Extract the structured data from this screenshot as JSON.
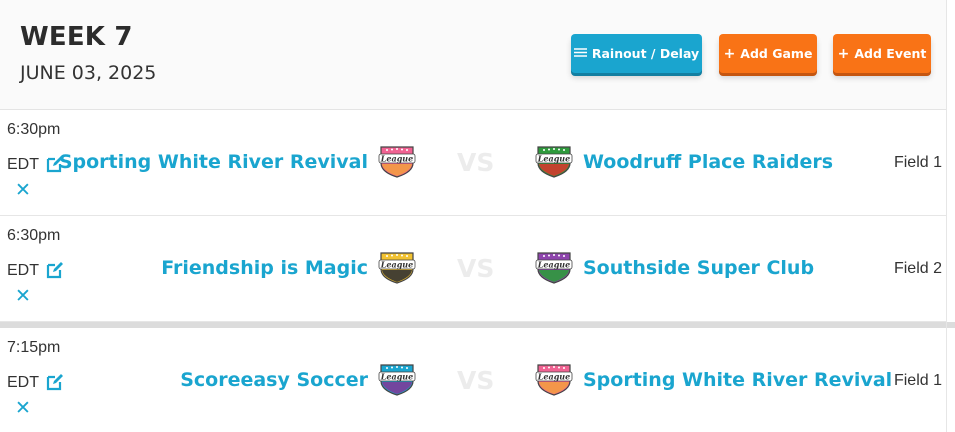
{
  "header": {
    "week_title": "WEEK 7",
    "date": "JUNE 03, 2025",
    "buttons": {
      "rainout": {
        "icon": "waves-icon",
        "label": "Rainout / Delay",
        "color": "#1aa5cf"
      },
      "add_game": {
        "icon": "plus-icon",
        "label": "Add Game",
        "color": "#f97316"
      },
      "add_event": {
        "icon": "plus-icon",
        "label": "Add Event",
        "color": "#f97316"
      }
    }
  },
  "vs_label": "VS",
  "games": [
    {
      "time": "6:30pm",
      "timezone": "EDT",
      "home": {
        "name": "Sporting White River Revival",
        "badge_color": "#f06292",
        "badge_stripe": "#f39c42",
        "badge_text": "League"
      },
      "away": {
        "name": "Woodruff Place Raiders",
        "badge_color": "#2e9a3c",
        "badge_stripe": "#d33a2c",
        "badge_text": "League"
      },
      "field": "Field 1"
    },
    {
      "time": "6:30pm",
      "timezone": "EDT",
      "home": {
        "name": "Friendship is Magic",
        "badge_color": "#f2c230",
        "badge_stripe": "#333333",
        "badge_text": "League"
      },
      "away": {
        "name": "Southside Super Club",
        "badge_color": "#8e44ad",
        "badge_stripe": "#2e9a3c",
        "badge_text": "League"
      },
      "field": "Field 2"
    },
    {
      "time": "7:15pm",
      "timezone": "EDT",
      "home": {
        "name": "Scoreeasy Soccer",
        "badge_color": "#1aa5cf",
        "badge_stripe": "#7d3c98",
        "badge_text": "League"
      },
      "away": {
        "name": "Sporting White River Revival",
        "badge_color": "#f06292",
        "badge_stripe": "#f39c42",
        "badge_text": "League"
      },
      "field": "Field 1"
    }
  ]
}
